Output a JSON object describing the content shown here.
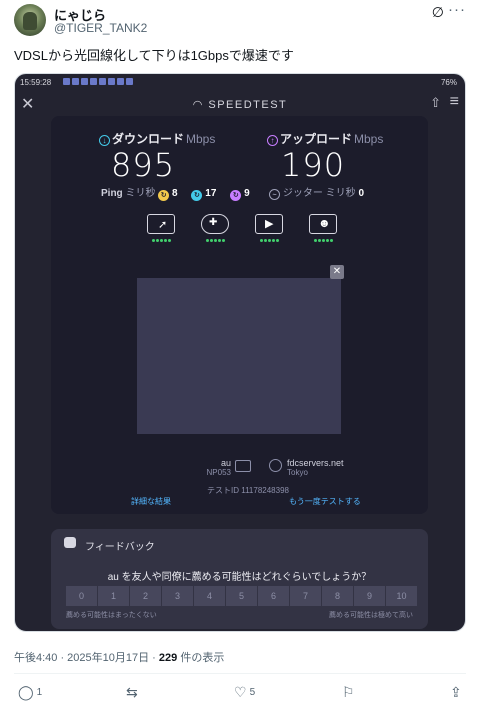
{
  "post": {
    "display_name": "にゃじら",
    "handle": "@TIGER_TANK2",
    "text": "VDSLから光回線化して下りは1Gbpsで爆速です",
    "timestamp": "午後4:40 · 2025年10月17日 ·",
    "views_count": "229",
    "views_label": "件の表示",
    "replies": "1",
    "retweets": "",
    "likes": "5",
    "icons": [
      "grok-icon",
      "more-icon",
      "reply-icon",
      "retweet-icon",
      "like-icon",
      "bookmark-icon",
      "share-icon"
    ]
  },
  "screenshot": {
    "status_time": "15:59:28",
    "battery": "76%",
    "brand": "SPEEDTEST",
    "download_label": "ダウンロード",
    "upload_label": "アップロード",
    "unit": "Mbps",
    "download_value": "895",
    "upload_value": "190",
    "ping_label": "Ping",
    "ping_unit": "ミリ秒",
    "ping_idle": "8",
    "ping_download": "17",
    "ping_upload": "9",
    "jitter_label": "ジッター",
    "jitter_unit": "ミリ秒",
    "jitter_value": "0",
    "isp_name": "au",
    "isp_code": "NP053",
    "server_host": "fdcservers.net",
    "server_city": "Tokyo",
    "test_id": "テストID 11178248398",
    "detail_link": "詳細な結果",
    "retest_link": "もう一度テストする",
    "feedback_title": "フィードバック",
    "feedback_question": "au を友人や同僚に薦める可能性はどれぐらいでしょうか？",
    "scale": [
      "0",
      "1",
      "2",
      "3",
      "4",
      "5",
      "6",
      "7",
      "8",
      "9",
      "10"
    ],
    "scale_low": "薦める可能性はまったくない",
    "scale_high": "薦める可能性は極めて高い",
    "colors": {
      "background": "#232330",
      "card": "#1c1c2b",
      "download": "#43c9e8",
      "upload": "#c77dff",
      "link": "#53b7ff"
    }
  }
}
